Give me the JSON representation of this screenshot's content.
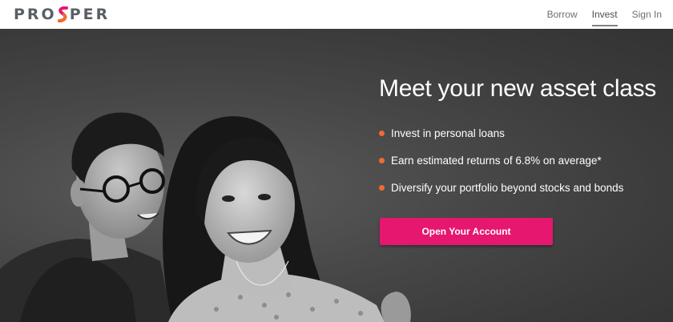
{
  "brand": {
    "name_left": "PRO",
    "name_right": "PER",
    "logo_accent_color": "#e5176f",
    "logo_accent_color_2": "#f26a2e"
  },
  "nav": {
    "items": [
      {
        "label": "Borrow",
        "active": false
      },
      {
        "label": "Invest",
        "active": true
      },
      {
        "label": "Sign In",
        "active": false
      }
    ]
  },
  "hero": {
    "headline": "Meet your new asset class",
    "bullets": [
      "Invest in personal loans",
      "Earn estimated returns of 6.8% on average*",
      "Diversify your portfolio beyond stocks and bonds"
    ],
    "bullet_color": "#f26a2e",
    "cta_label": "Open Your Account",
    "cta_color": "#e5176f"
  }
}
